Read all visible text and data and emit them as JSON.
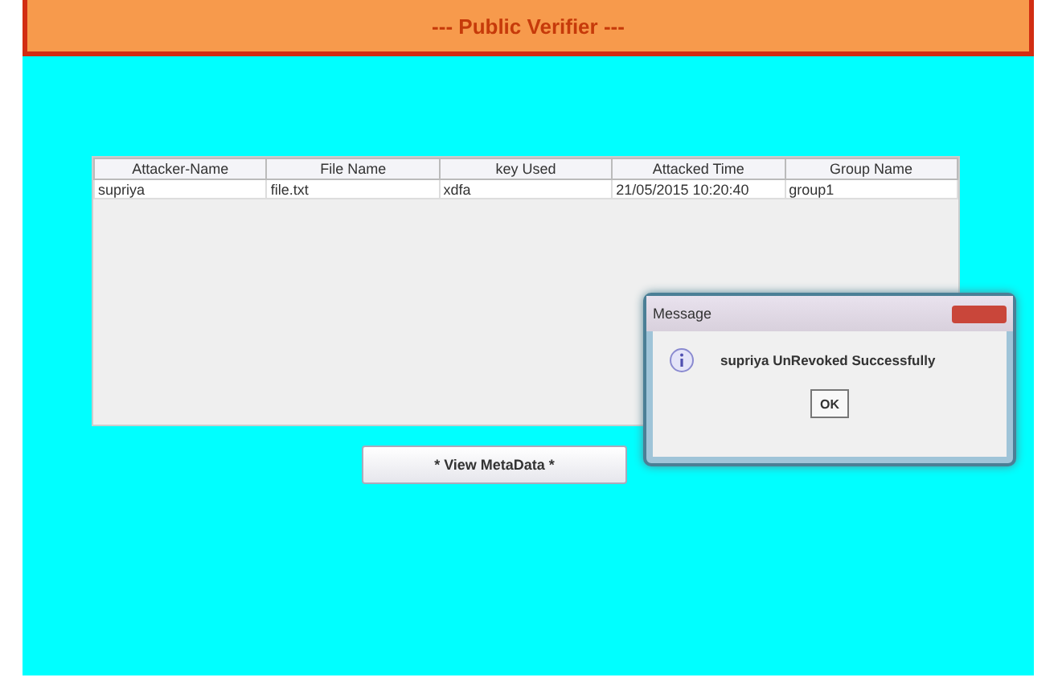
{
  "header": {
    "title": "--- Public Verifier ---"
  },
  "table": {
    "columns": [
      "Attacker-Name",
      "File Name",
      "key Used",
      "Attacked Time",
      "Group Name"
    ],
    "rows": [
      [
        "supriya",
        "file.txt",
        "xdfa",
        "21/05/2015 10:20:40",
        "group1"
      ]
    ]
  },
  "button": {
    "label": "* View MetaData *"
  },
  "dialog": {
    "title": "Message",
    "message": "supriya UnRevoked Successfully",
    "ok": "OK"
  }
}
